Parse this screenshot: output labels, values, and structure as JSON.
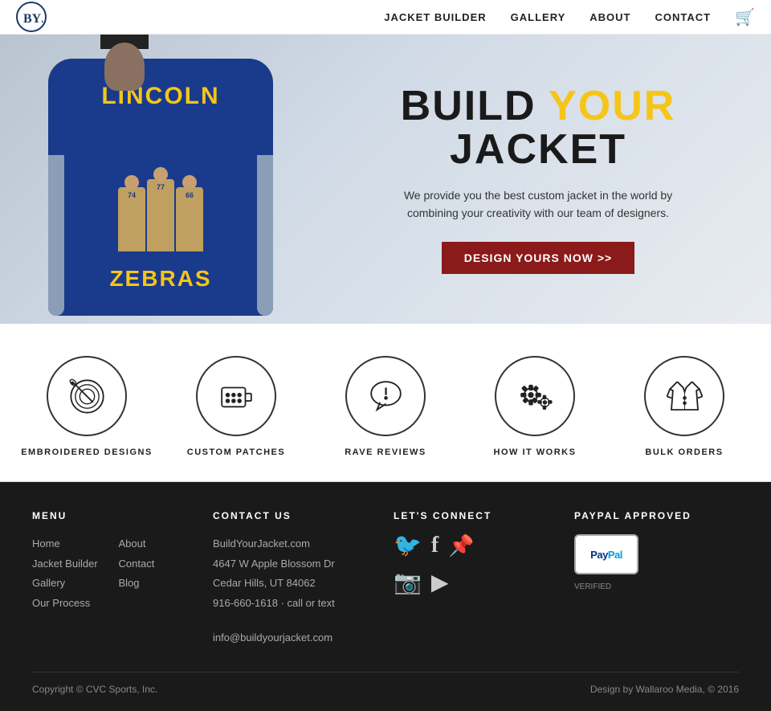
{
  "nav": {
    "logo_text": "BYJ",
    "links": [
      {
        "label": "JACKET BUILDER",
        "id": "jacket-builder"
      },
      {
        "label": "GALLERY",
        "id": "gallery"
      },
      {
        "label": "ABOUT",
        "id": "about"
      },
      {
        "label": "CONTACT",
        "id": "contact"
      }
    ]
  },
  "hero": {
    "title_part1": "BUILD ",
    "title_your": "YOUR",
    "title_part2": " JACKET",
    "subtitle": "We provide you the best custom jacket in the world by combining your creativity with our team of designers.",
    "cta_label": "DESIGN YOURS NOW >>",
    "jacket_text_top": "LINCOLN",
    "jacket_text_bottom": "ZEBRAS",
    "player_numbers": [
      "74",
      "77",
      "66"
    ]
  },
  "features": [
    {
      "id": "embroidered",
      "label": "EMBROIDERED DESIGNS",
      "icon": "needle"
    },
    {
      "id": "patches",
      "label": "CUSTOM PATCHES",
      "icon": "patches"
    },
    {
      "id": "reviews",
      "label": "RAVE REVIEWS",
      "icon": "speech"
    },
    {
      "id": "how",
      "label": "HOW IT WORKS",
      "icon": "gears"
    },
    {
      "id": "bulk",
      "label": "BULK ORDERS",
      "icon": "jacket"
    }
  ],
  "footer": {
    "menu_title": "MENU",
    "contact_title": "CONTACT US",
    "connect_title": "LET'S CONNECT",
    "paypal_title": "PAYPAL APPROVED",
    "nav_links": [
      {
        "label": "Home"
      },
      {
        "label": "About"
      },
      {
        "label": "Jacket Builder"
      },
      {
        "label": "Contact"
      },
      {
        "label": "Gallery"
      },
      {
        "label": "Blog"
      },
      {
        "label": "Our Process"
      }
    ],
    "contact_info": {
      "website": "BuildYourJacket.com",
      "address": "4647 W Apple Blossom Dr",
      "city": "Cedar Hills, UT 84062",
      "phone": "916-660-1618 · call or text",
      "email": "info@buildyourjacket.com"
    },
    "social": [
      {
        "icon": "𝕏",
        "label": "twitter",
        "unicode": "🐦"
      },
      {
        "icon": "f",
        "label": "facebook"
      },
      {
        "icon": "𝐏",
        "label": "pinterest"
      },
      {
        "icon": "📷",
        "label": "instagram"
      },
      {
        "icon": "▶",
        "label": "youtube"
      }
    ],
    "copyright": "Copyright © CVC Sports, Inc.",
    "design_credit": "Design by Wallaroo Media, © 2016"
  }
}
